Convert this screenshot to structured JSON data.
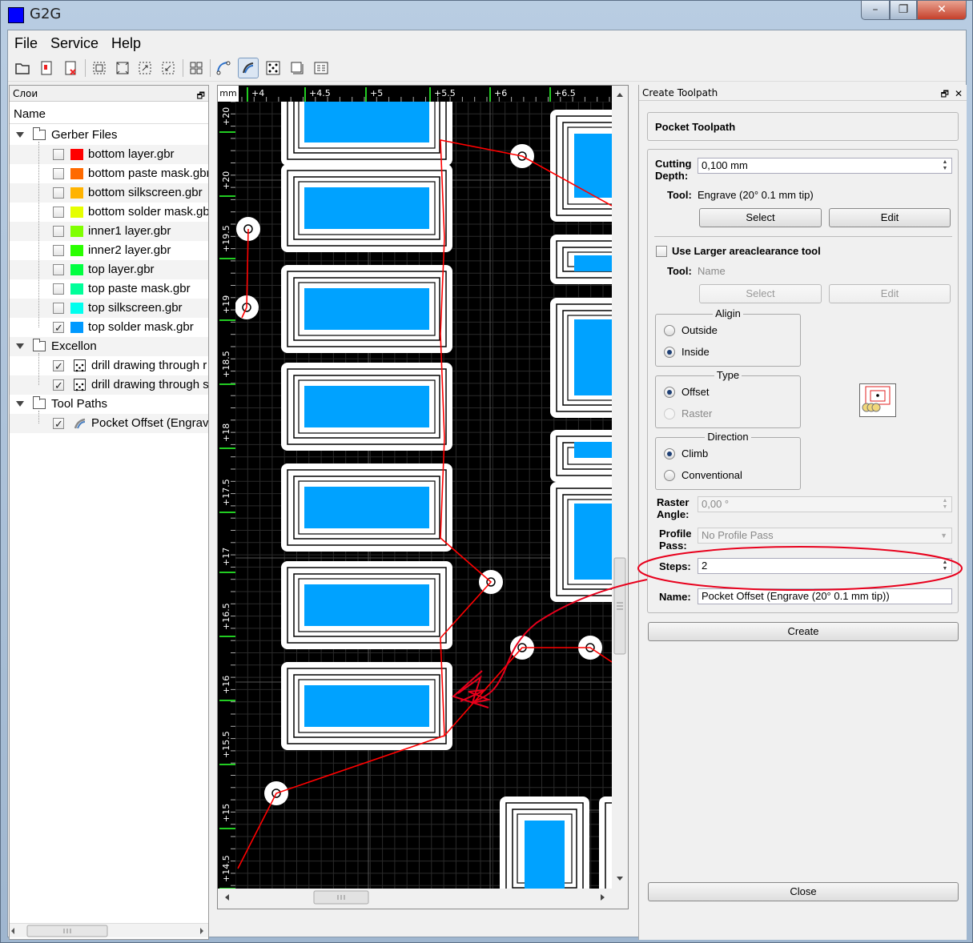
{
  "window": {
    "title": "G2G",
    "min": "–",
    "max": "❐",
    "close": "✕"
  },
  "menu": [
    "File",
    "Service",
    "Help"
  ],
  "left_dock": {
    "title": "Слои",
    "float_glyph": "🗗",
    "column": "Name",
    "groups": [
      {
        "label": "Gerber Files",
        "items": [
          {
            "label": "bottom layer.gbr",
            "color": "#ff0000",
            "checked": false
          },
          {
            "label": "bottom paste mask.gbr",
            "color": "#ff6a00",
            "checked": false
          },
          {
            "label": "bottom silkscreen.gbr",
            "color": "#ffb300",
            "checked": false
          },
          {
            "label": "bottom solder mask.gbr",
            "color": "#e5ff00",
            "checked": false
          },
          {
            "label": "inner1 layer.gbr",
            "color": "#7fff00",
            "checked": false
          },
          {
            "label": "inner2 layer.gbr",
            "color": "#2aff00",
            "checked": false
          },
          {
            "label": "top layer.gbr",
            "color": "#00ff40",
            "checked": false
          },
          {
            "label": "top paste mask.gbr",
            "color": "#00ff99",
            "checked": false
          },
          {
            "label": "top silkscreen.gbr",
            "color": "#00ffee",
            "checked": false
          },
          {
            "label": "top solder mask.gbr",
            "color": "#0099ff",
            "checked": true
          }
        ]
      },
      {
        "label": "Excellon",
        "items": [
          {
            "label": "drill drawing through r",
            "checked": true
          },
          {
            "label": "drill drawing through s",
            "checked": true
          }
        ]
      },
      {
        "label": "Tool Paths",
        "items": [
          {
            "label": "Pocket Offset (Engrave",
            "checked": true
          }
        ]
      }
    ]
  },
  "canvas": {
    "units": "mm",
    "x_ticks": [
      "+4",
      "+4.5",
      "+5",
      "+5.5",
      "+6",
      "+6.5"
    ],
    "y_ticks": [
      "+20",
      "+20",
      "+19.5",
      "+19",
      "+18.5",
      "+18",
      "+17.5",
      "+17",
      "+16.5",
      "+16",
      "+15.5",
      "+15",
      "+14.5"
    ]
  },
  "panel": {
    "title": "Create Toolpath",
    "float_glyph": "🗗",
    "close_glyph": "✕",
    "header": "Pocket Toolpath",
    "cutting_depth_label": "Cutting Depth:",
    "cutting_depth_label_1": "Cutting",
    "cutting_depth_label_2": "Depth:",
    "cutting_depth_value": "0,100 mm",
    "tool_label": "Tool:",
    "tool_value": "Engrave (20° 0.1 mm tip)",
    "select": "Select",
    "edit": "Edit",
    "use_larger": "Use Larger areaclearance tool",
    "tool2_label": "Tool:",
    "tool2_value": "Name",
    "align_title": "Aligin",
    "align_outside": "Outside",
    "align_inside": "Inside",
    "type_title": "Type",
    "type_offset": "Offset",
    "type_raster": "Raster",
    "direction_title": "Direction",
    "dir_climb": "Climb",
    "dir_conventional": "Conventional",
    "raster_angle_1": "Raster",
    "raster_angle_2": "Angle:",
    "raster_angle_value": "0,00 °",
    "profile_pass_1": "Profile",
    "profile_pass_2": "Pass:",
    "profile_pass_value": "No Profile Pass",
    "steps_label": "Steps:",
    "steps_value": "2",
    "name_label": "Name:",
    "name_value": "Pocket Offset (Engrave (20° 0.1 mm tip))",
    "create": "Create",
    "close": "Close"
  },
  "colors": {
    "pad": "#00a2ff",
    "path": "#ff0000",
    "annotation": "#e8001c"
  }
}
